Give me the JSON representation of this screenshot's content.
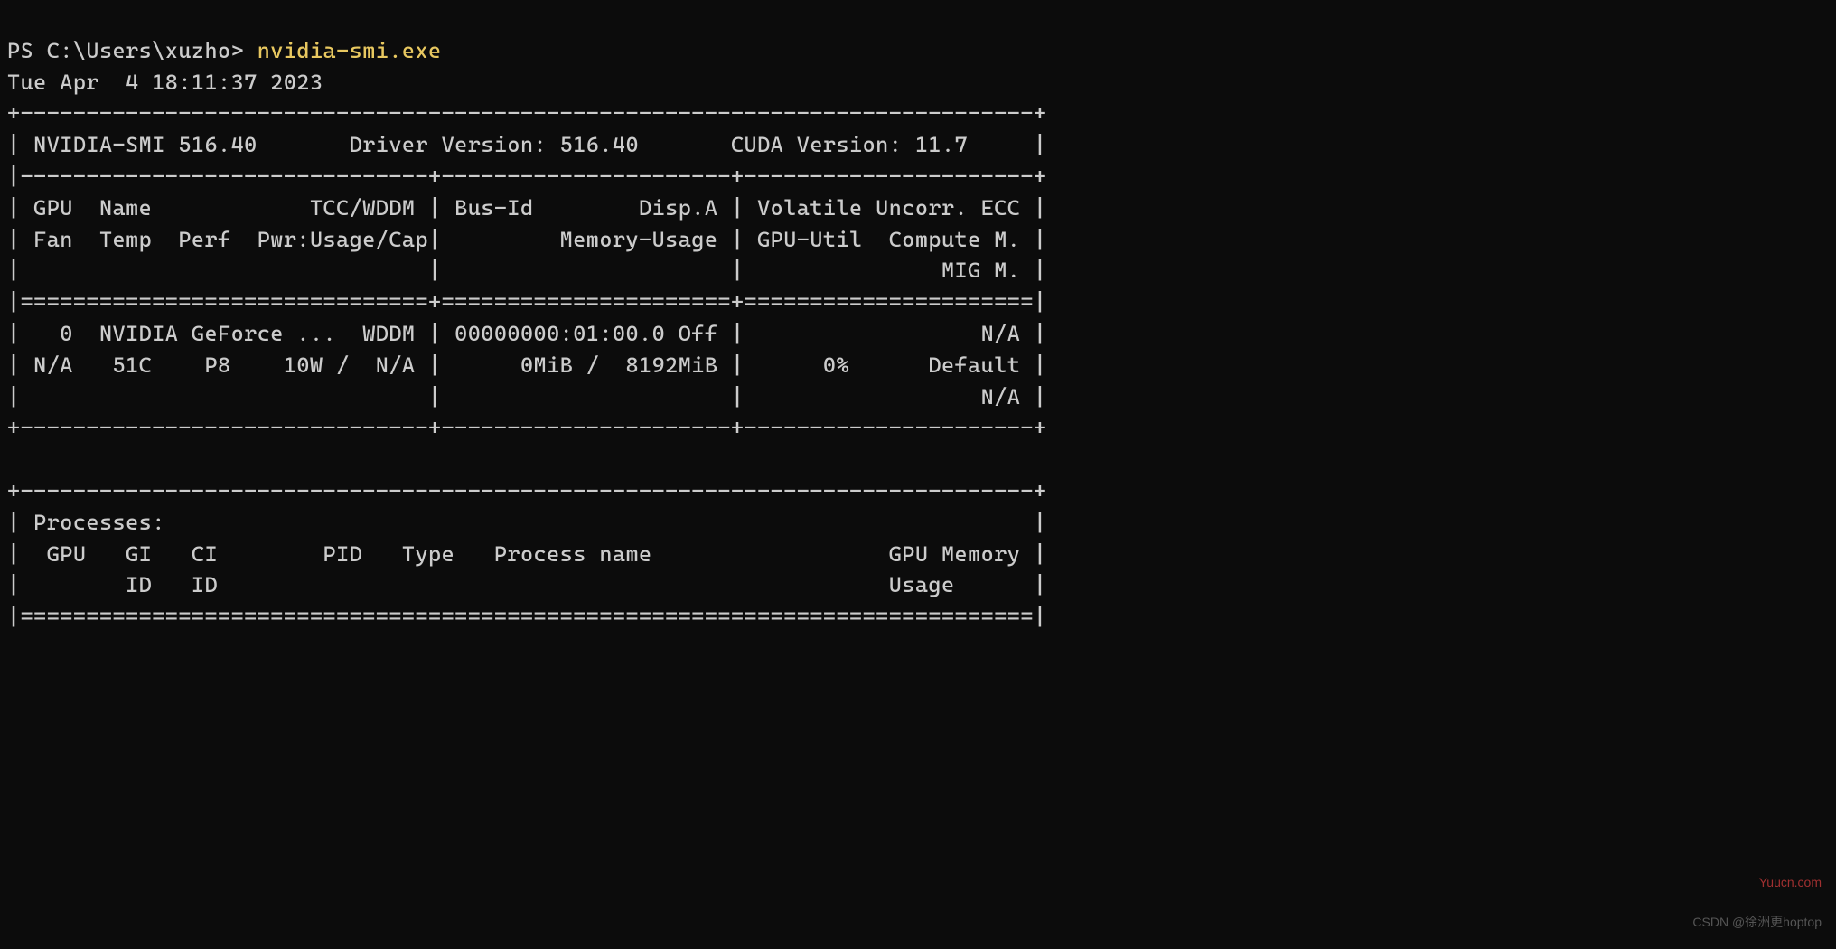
{
  "prompt": "PS C:\\Users\\xuzho> ",
  "command": "nvidia-smi.exe",
  "timestamp": "Tue Apr  4 18:11:37 2023",
  "table1_top": "+-----------------------------------------------------------------------------+",
  "info_line": "| NVIDIA-SMI 516.40       Driver Version: 516.40       CUDA Version: 11.7     |",
  "hdr_sep": "|-------------------------------+----------------------+----------------------+",
  "hdr1": "| GPU  Name            TCC/WDDM | Bus-Id        Disp.A | Volatile Uncorr. ECC |",
  "hdr2": "| Fan  Temp  Perf  Pwr:Usage/Cap|         Memory-Usage | GPU-Util  Compute M. |",
  "hdr3": "|                               |                      |               MIG M. |",
  "eq_sep": "|===============================+======================+======================|",
  "row1": "|   0  NVIDIA GeForce ...  WDDM | 00000000:01:00.0 Off |                  N/A |",
  "row2": "| N/A   51C    P8    10W /  N/A |      0MiB /  8192MiB |      0%      Default |",
  "row3": "|                               |                      |                  N/A |",
  "table1_bot": "+-------------------------------+----------------------+----------------------+",
  "blank": "                                                                               ",
  "table2_top": "+-----------------------------------------------------------------------------+",
  "proc_title": "| Processes:                                                                  |",
  "proc_hdr1": "|  GPU   GI   CI        PID   Type   Process name                  GPU Memory |",
  "proc_hdr2": "|        ID   ID                                                   Usage      |",
  "proc_eq": "|=============================================================================|",
  "smi_version": "516.40",
  "driver_version": "516.40",
  "cuda_version": "11.7",
  "gpu": {
    "index": 0,
    "name": "NVIDIA GeForce ...",
    "mode": "WDDM",
    "bus_id": "00000000:01:00.0",
    "display_active": "Off",
    "ecc": "N/A",
    "fan": "N/A",
    "temp": "51C",
    "perf": "P8",
    "pwr_usage": "10W",
    "pwr_cap": "N/A",
    "mem_used": "0MiB",
    "mem_total": "8192MiB",
    "gpu_util": "0%",
    "compute_mode": "Default",
    "mig_mode": "N/A"
  },
  "watermark1": "Yuucn.com",
  "watermark2": "CSDN @徐洲更hoptop"
}
